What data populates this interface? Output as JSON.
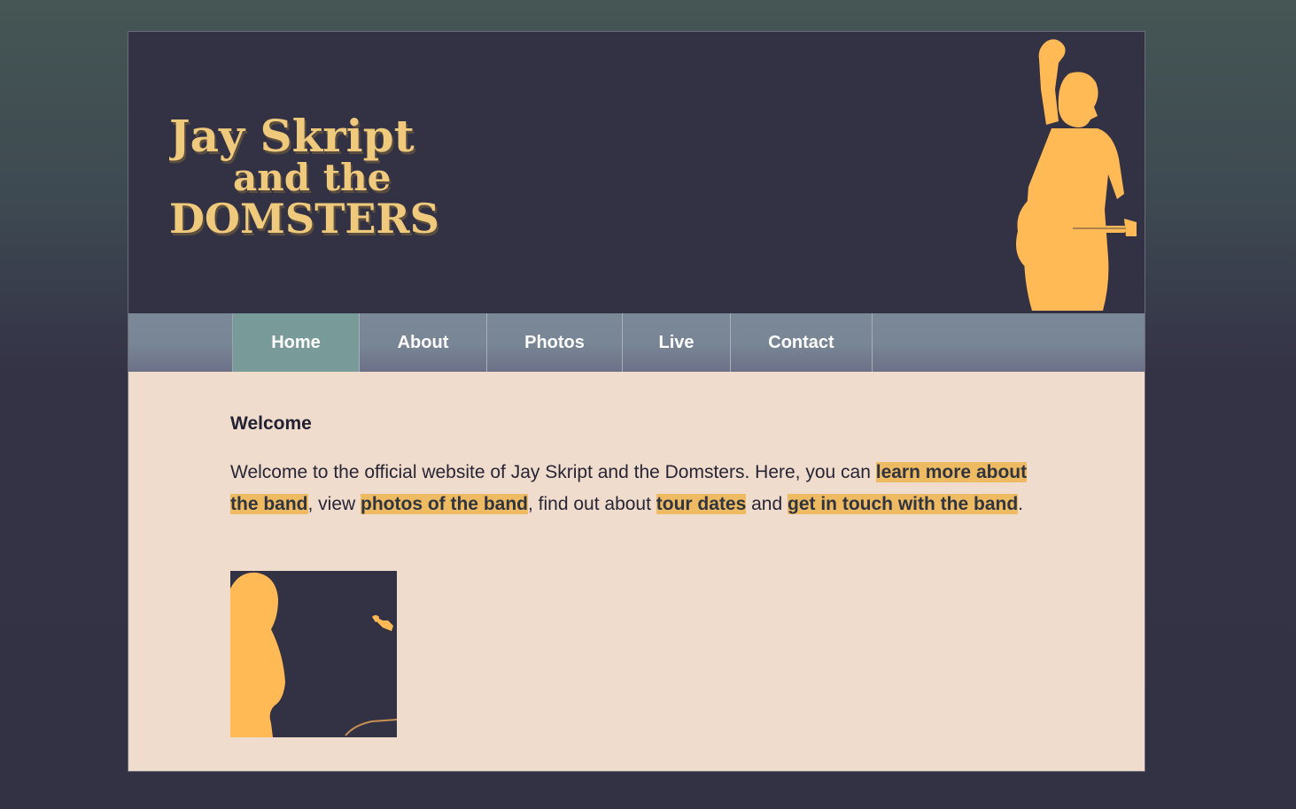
{
  "header": {
    "logo_line1": "Jay Skript",
    "logo_line2": "and the",
    "logo_line3": "DOMSTERS"
  },
  "nav": {
    "items": [
      {
        "label": "Home",
        "active": true
      },
      {
        "label": "About",
        "active": false
      },
      {
        "label": "Photos",
        "active": false
      },
      {
        "label": "Live",
        "active": false
      },
      {
        "label": "Contact",
        "active": false
      }
    ]
  },
  "main": {
    "heading": "Welcome",
    "intro_text_1": "Welcome to the official website of Jay Skript and the Domsters. Here, you can ",
    "link_about": "learn more about the band",
    "intro_text_2": ", view ",
    "link_photos": "photos of the band",
    "intro_text_3": ", find out about ",
    "link_live": "tour dates",
    "intro_text_4": " and ",
    "link_contact": "get in touch with the band",
    "intro_text_5": "."
  },
  "colors": {
    "accent": "#ffb955",
    "header_bg": "#333245",
    "content_bg": "#efdccc",
    "highlight": "#eebb62",
    "nav_active": "#789a98"
  }
}
